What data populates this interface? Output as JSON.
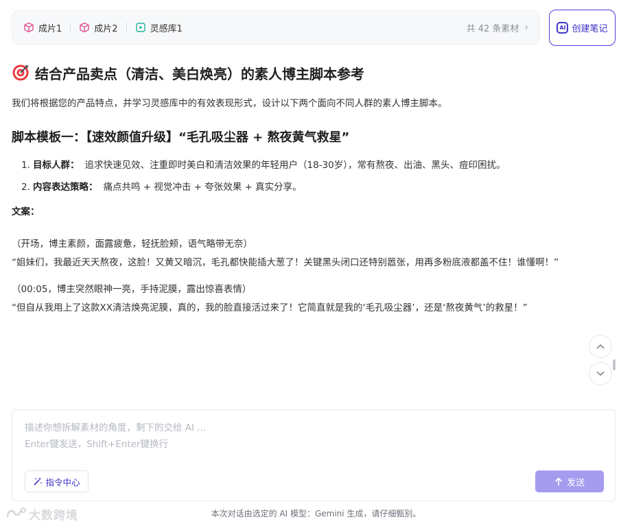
{
  "sources": {
    "chips": [
      {
        "label": "成片1",
        "icon": "cube-icon",
        "color": "#e0538f"
      },
      {
        "label": "成片2",
        "icon": "cube-icon",
        "color": "#e0538f"
      },
      {
        "label": "灵感库1",
        "icon": "play-card-icon",
        "color": "#1fb59a"
      }
    ],
    "count_text": "共 42 条素材",
    "chevron": "›"
  },
  "note_button": {
    "label": "创建笔记",
    "icon": "ai-note-icon",
    "badge": "AI"
  },
  "article": {
    "title": "结合产品卖点（清洁、美白焕亮）的素人博主脚本参考",
    "title_icon": "target-icon",
    "intro": "我们将根据您的产品特点，并学习灵感库中的有效表现形式，设计以下两个面向不同人群的素人博主脚本。",
    "section1_heading": "脚本模板一：【速效颜值升级】“毛孔吸尘器 + 熬夜黄气救星”",
    "points": [
      {
        "num": "1.",
        "label": "目标人群：",
        "text": "追求快速见效、注重即时美白和清洁效果的年轻用户（18-30岁），常有熬夜、出油、黑头、痘印困扰。"
      },
      {
        "num": "2.",
        "label": "内容表达策略：",
        "text": "痛点共鸣 + 视觉冲击 + 夸张效果 + 真实分享。"
      }
    ],
    "copy_label": "文案：",
    "para1_action": "（开场，博主素颜，面露疲惫，轻抚脸颊，语气略带无奈）",
    "para1_quote": "“姐妹们，我最近天天熬夜，这脸！又黄又暗沉，毛孔都快能插大葱了！关键黑头闭口还特别嚣张，用再多粉底液都盖不住！谁懂啊！”",
    "para2_action": "（00:05，博主突然眼神一亮，手持泥膜，露出惊喜表情）",
    "para2_quote": "“但自从我用上了这款XX清洁焕亮泥膜，真的，我的脸直接活过来了！它简直就是我的‘毛孔吸尘器’，还是‘熬夜黄气’的救星！”"
  },
  "scroll": {
    "up_icon": "chevron-up-icon",
    "down_icon": "chevron-down-icon"
  },
  "composer": {
    "placeholder": "描述你想拆解素材的角度，剩下的交给 AI ...\nEnter键发送，Shift+Enter键换行",
    "command_label": "指令中心",
    "command_icon": "magic-wand-icon",
    "send_label": "发送",
    "send_icon": "arrow-up-icon",
    "accent": "#3d33c7",
    "send_bg": "#a59cf0"
  },
  "footer": {
    "disclaimer": "本次对话由选定的 AI 模型：Gemini 生成，请仔细甄别。",
    "watermark": "大数跨境"
  }
}
